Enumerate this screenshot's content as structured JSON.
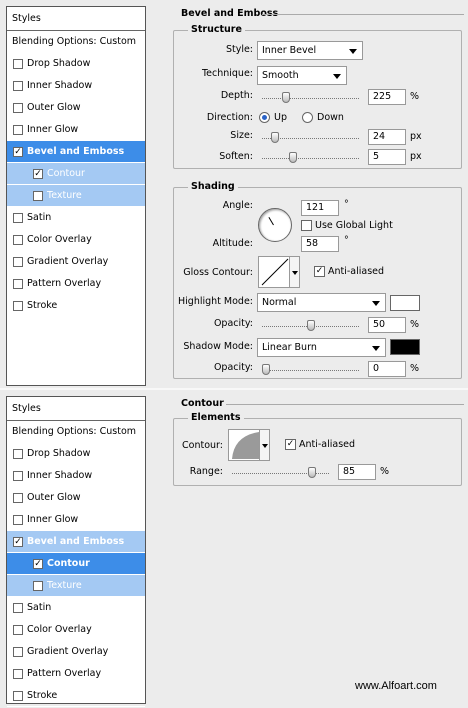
{
  "panel1": {
    "styles_header": "Styles",
    "items": [
      {
        "label": "Blending Options: Custom",
        "checked": null,
        "state": ""
      },
      {
        "label": "Drop Shadow",
        "checked": false,
        "state": ""
      },
      {
        "label": "Inner Shadow",
        "checked": false,
        "state": ""
      },
      {
        "label": "Outer Glow",
        "checked": false,
        "state": ""
      },
      {
        "label": "Inner Glow",
        "checked": false,
        "state": ""
      },
      {
        "label": "Bevel and Emboss",
        "checked": true,
        "state": "selected"
      },
      {
        "label": "Contour",
        "checked": true,
        "state": "sub-light"
      },
      {
        "label": "Texture",
        "checked": false,
        "state": "sub-light"
      },
      {
        "label": "Satin",
        "checked": false,
        "state": ""
      },
      {
        "label": "Color Overlay",
        "checked": false,
        "state": ""
      },
      {
        "label": "Gradient Overlay",
        "checked": false,
        "state": ""
      },
      {
        "label": "Pattern Overlay",
        "checked": false,
        "state": ""
      },
      {
        "label": "Stroke",
        "checked": false,
        "state": ""
      }
    ],
    "section_title": "Bevel and Emboss",
    "structure": {
      "title": "Structure",
      "style_label": "Style:",
      "style_value": "Inner Bevel",
      "technique_label": "Technique:",
      "technique_value": "Smooth",
      "depth_label": "Depth:",
      "depth_value": "225",
      "depth_unit": "%",
      "depth_level": 0.225,
      "direction_label": "Direction:",
      "up_label": "Up",
      "down_label": "Down",
      "direction_selected": "Up",
      "size_label": "Size:",
      "size_value": "24",
      "size_unit": "px",
      "size_level": 0.1,
      "soften_label": "Soften:",
      "soften_value": "5",
      "soften_unit": "px",
      "soften_level": 0.3
    },
    "shading": {
      "title": "Shading",
      "angle_label": "Angle:",
      "angle_value": "121",
      "angle_unit": "°",
      "use_global_light_label": "Use Global Light",
      "use_global_light": false,
      "altitude_label": "Altitude:",
      "altitude_value": "58",
      "altitude_unit": "°",
      "gloss_contour_label": "Gloss Contour:",
      "gloss_anti_aliased_label": "Anti-aliased",
      "gloss_anti_aliased": true,
      "highlight_mode_label": "Highlight Mode:",
      "highlight_mode_value": "Normal",
      "highlight_color": "#ffffff",
      "highlight_opacity_label": "Opacity:",
      "highlight_opacity_value": "50",
      "highlight_opacity_unit": "%",
      "highlight_opacity_level": 0.5,
      "shadow_mode_label": "Shadow Mode:",
      "shadow_mode_value": "Linear Burn",
      "shadow_color": "#000000",
      "shadow_opacity_label": "Opacity:",
      "shadow_opacity_value": "0",
      "shadow_opacity_unit": "%",
      "shadow_opacity_level": 0.0
    }
  },
  "panel2": {
    "styles_header": "Styles",
    "items": [
      {
        "label": "Blending Options: Custom",
        "checked": null,
        "state": ""
      },
      {
        "label": "Drop Shadow",
        "checked": false,
        "state": ""
      },
      {
        "label": "Inner Shadow",
        "checked": false,
        "state": ""
      },
      {
        "label": "Outer Glow",
        "checked": false,
        "state": ""
      },
      {
        "label": "Inner Glow",
        "checked": false,
        "state": ""
      },
      {
        "label": "Bevel and Emboss",
        "checked": true,
        "state": "parent-light"
      },
      {
        "label": "Contour",
        "checked": true,
        "state": "sub-selected"
      },
      {
        "label": "Texture",
        "checked": false,
        "state": "sub-light"
      },
      {
        "label": "Satin",
        "checked": false,
        "state": ""
      },
      {
        "label": "Color Overlay",
        "checked": false,
        "state": ""
      },
      {
        "label": "Gradient Overlay",
        "checked": false,
        "state": ""
      },
      {
        "label": "Pattern Overlay",
        "checked": false,
        "state": ""
      },
      {
        "label": "Stroke",
        "checked": false,
        "state": ""
      }
    ],
    "section_title": "Contour",
    "elements": {
      "title": "Elements",
      "contour_label": "Contour:",
      "anti_aliased_label": "Anti-aliased",
      "anti_aliased": true,
      "range_label": "Range:",
      "range_value": "85",
      "range_unit": "%",
      "range_level": 0.85
    }
  },
  "colors": {
    "selected": "#3d8de8",
    "sub_light": "#a4c9f3"
  },
  "watermark": "www.Alfoart.com"
}
